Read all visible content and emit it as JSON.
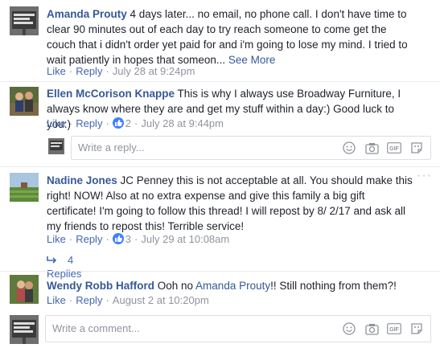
{
  "comments": [
    {
      "author": "Amanda Prouty",
      "text": " 4 days later... no email, no phone call. I don't have time to clear 90 minutes out of each day to try reach someone to come get the couch that i didn't order yet paid for and i'm going to lose my mind. I tried to wait patiently in hopes that someon... ",
      "see_more": "See More",
      "like": "Like",
      "reply": "Reply",
      "timestamp": "July 28 at 9:24pm"
    },
    {
      "author": "Ellen McCorison Knappe",
      "text": " This is why I always use Broadway Furniture, I always know where they are and get my stuff within a day:) Good luck to you:)",
      "like": "Like",
      "reply": "Reply",
      "likes": "2",
      "timestamp": "July 28 at 9:44pm"
    },
    {
      "author": "Nadine Jones",
      "text": " JC Penney this is not acceptable at all. You should make this right! NOW! Also at no extra expense and give this family a big gift certificate! I'm going to follow this thread! I will repost by 8/ 2/17 and ask all my friends to repost this! Terrible service!",
      "like": "Like",
      "reply": "Reply",
      "likes": "3",
      "timestamp": "July 29 at 10:08am",
      "replies": "4 Replies"
    },
    {
      "author": "Wendy Robb Hafford",
      "text_before": " Ooh no ",
      "mention": "Amanda Prouty",
      "text_after": "!! Still nothing from them?!",
      "like": "Like",
      "reply": "Reply",
      "timestamp": "August 2 at 10:20pm"
    }
  ],
  "reply_placeholder": "Write a reply...",
  "comment_placeholder": "Write a comment...",
  "avatar_text": "YOU NEVER THIS & SINCE 1972",
  "dot": "·",
  "more": "···",
  "composer_icons": [
    "emoji-icon",
    "camera-icon",
    "gif-icon",
    "sticker-icon"
  ],
  "colors": {
    "link": "#365899",
    "action": "#4267b2",
    "meta": "#90949c",
    "like_badge": "#4080ff"
  }
}
